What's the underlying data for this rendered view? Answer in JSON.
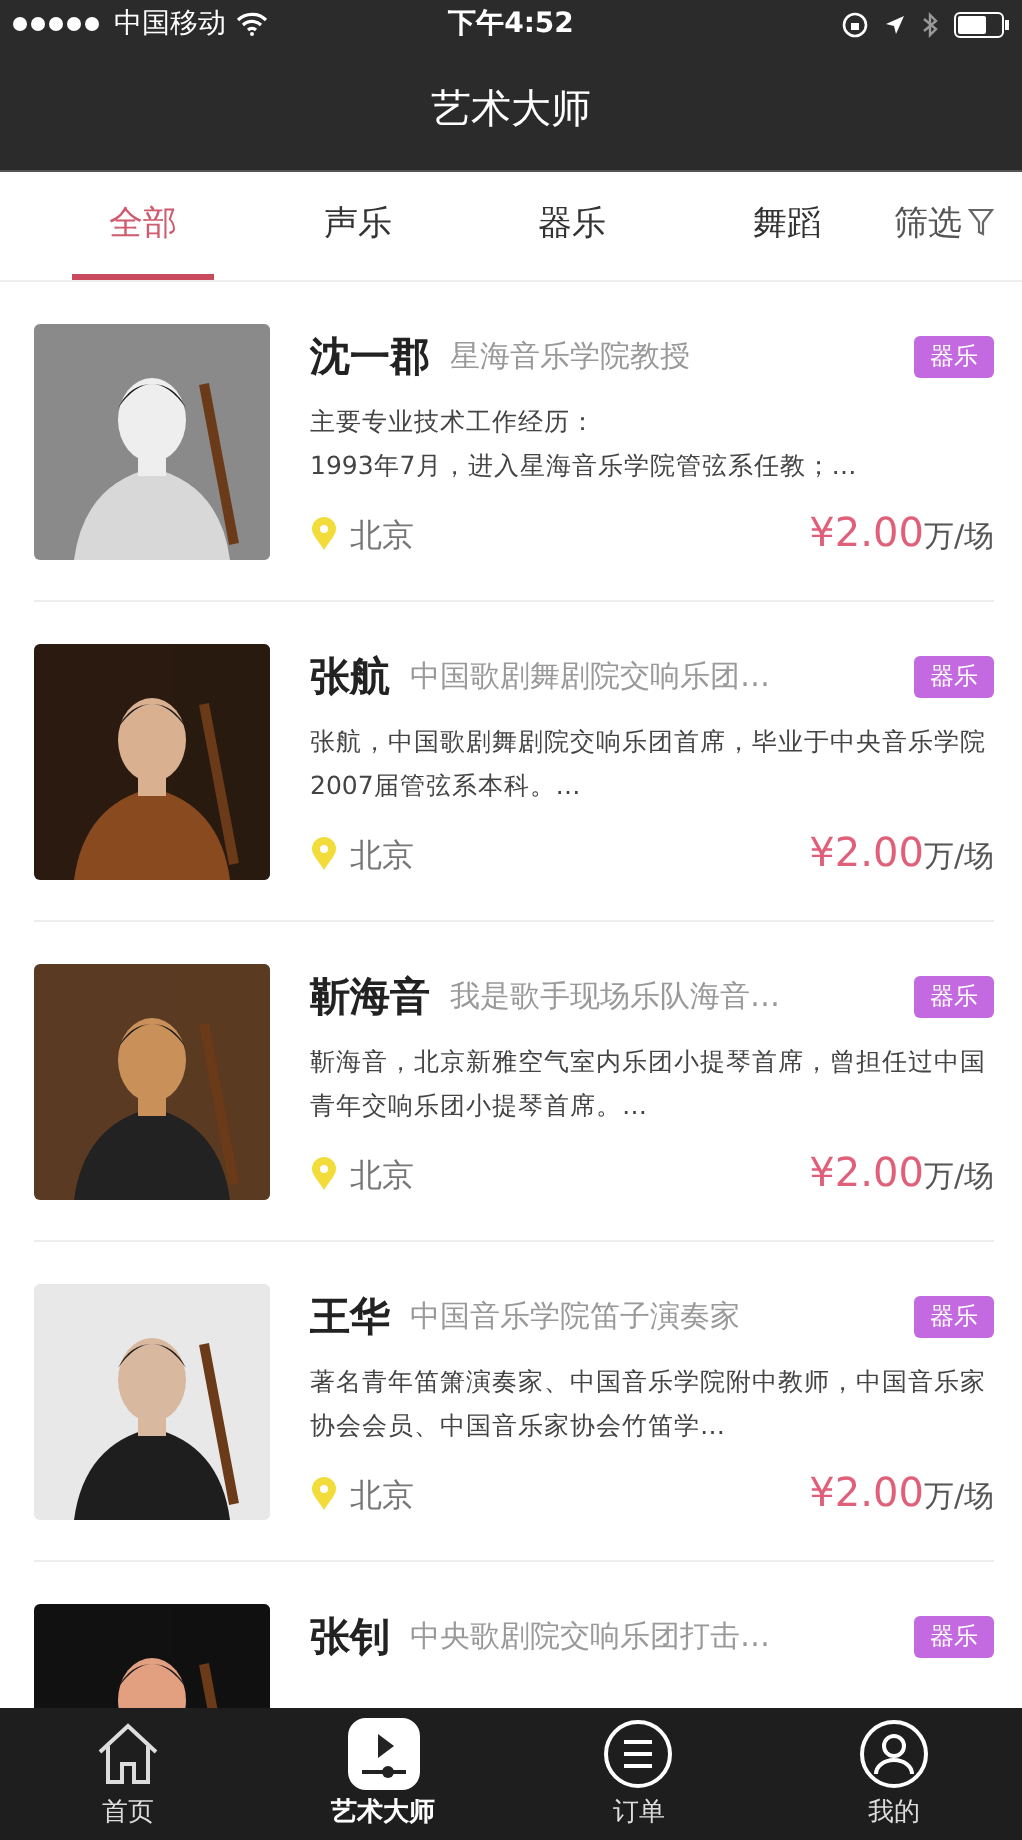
{
  "status_bar": {
    "carrier": "中国移动",
    "time": "下午4:52"
  },
  "header": {
    "title": "艺术大师"
  },
  "tabs": [
    {
      "label": "全部",
      "selected": true
    },
    {
      "label": "声乐",
      "selected": false
    },
    {
      "label": "器乐",
      "selected": false
    },
    {
      "label": "舞蹈",
      "selected": false
    }
  ],
  "filter": {
    "label": "筛选"
  },
  "artists": [
    {
      "name": "沈一郡",
      "title": "星海音乐学院教授",
      "tag": "器乐",
      "description": "主要专业技术工作经历：\n1993年7月，进入星海音乐学院管弦系任教；…",
      "location": "北京",
      "price": "¥2.00",
      "unit": "万/场"
    },
    {
      "name": "张航",
      "title": "中国歌剧舞剧院交响乐团…",
      "tag": "器乐",
      "description": "张航，中国歌剧舞剧院交响乐团首席，毕业于中央音乐学院2007届管弦系本科。…",
      "location": "北京",
      "price": "¥2.00",
      "unit": "万/场"
    },
    {
      "name": "靳海音",
      "title": "我是歌手现场乐队海音…",
      "tag": "器乐",
      "description": "靳海音，北京新雅空气室内乐团小提琴首席，曾担任过中国青年交响乐团小提琴首席。…",
      "location": "北京",
      "price": "¥2.00",
      "unit": "万/场"
    },
    {
      "name": "王华",
      "title": "中国音乐学院笛子演奏家",
      "tag": "器乐",
      "description": "著名青年笛箫演奏家、中国音乐学院附中教师，中国音乐家协会会员、中国音乐家协会竹笛学…",
      "location": "北京",
      "price": "¥2.00",
      "unit": "万/场"
    },
    {
      "name": "张钊",
      "title": "中央歌剧院交响乐团打击…",
      "tag": "器乐"
    }
  ],
  "bottom_nav": [
    {
      "label": "首页",
      "kind": "home",
      "selected": false
    },
    {
      "label": "艺术大师",
      "kind": "play",
      "selected": true
    },
    {
      "label": "订单",
      "kind": "list",
      "selected": false
    },
    {
      "label": "我的",
      "kind": "user",
      "selected": false
    }
  ]
}
